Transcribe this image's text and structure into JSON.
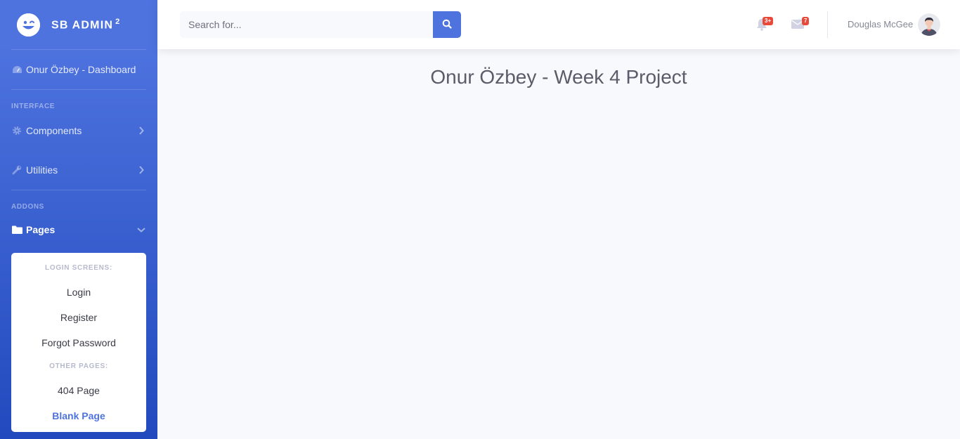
{
  "brand": {
    "name": "SB ADMIN",
    "sup": "2"
  },
  "sidebar": {
    "dashboard_label": "Onur Özbey - Dashboard",
    "heading_interface": "INTERFACE",
    "components_label": "Components",
    "utilities_label": "Utilities",
    "heading_addons": "ADDONS",
    "pages_label": "Pages",
    "collapse": {
      "header_login": "LOGIN SCREENS:",
      "login": "Login",
      "register": "Register",
      "forgot": "Forgot Password",
      "header_other": "OTHER PAGES:",
      "page404": "404 Page",
      "blank": "Blank Page"
    }
  },
  "topbar": {
    "search_placeholder": "Search for...",
    "alerts_badge": "3+",
    "messages_badge": "7",
    "user_name": "Douglas McGee"
  },
  "main": {
    "title": "Onur Özbey - Week 4 Project"
  },
  "colors": {
    "primary": "#4e73df",
    "danger": "#e74a3b",
    "gray": "#858796"
  }
}
